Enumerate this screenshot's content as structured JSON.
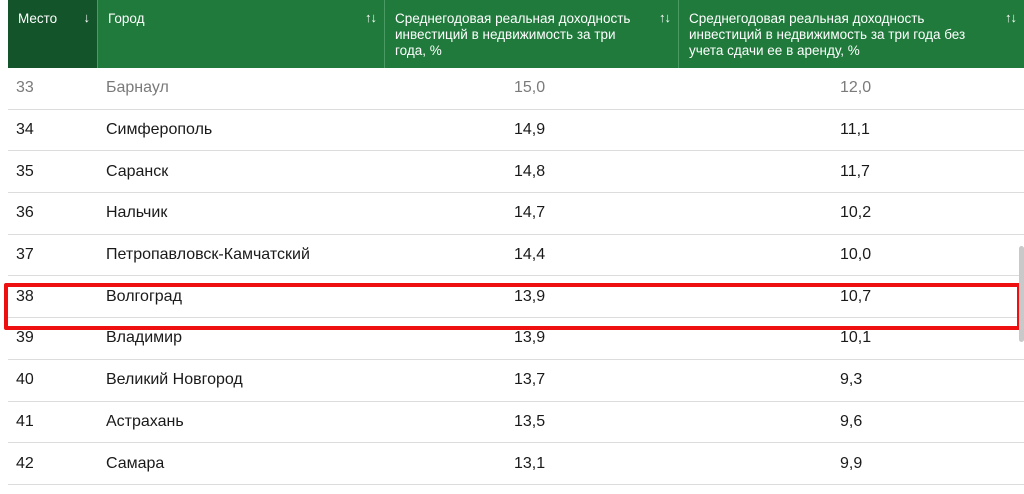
{
  "table": {
    "headers": {
      "place": "Место",
      "place_sort": "↓",
      "city": "Город",
      "city_sort": "↑↓",
      "yield": "Среднегодовая реальная доходность инвестиций в недвижимость за три года, %",
      "yield_sort": "↑↓",
      "yield_no_rent": "Среднегодовая реальная доходность инвестиций в недвижимость за три года без учета сдачи ее в аренду, %",
      "yield_no_rent_sort": "↑↓"
    },
    "rows": [
      {
        "place": "33",
        "city": "Барнаул",
        "yield": "15,0",
        "yield_no_rent": "12,0"
      },
      {
        "place": "34",
        "city": "Симферополь",
        "yield": "14,9",
        "yield_no_rent": "11,1"
      },
      {
        "place": "35",
        "city": "Саранск",
        "yield": "14,8",
        "yield_no_rent": "11,7"
      },
      {
        "place": "36",
        "city": "Нальчик",
        "yield": "14,7",
        "yield_no_rent": "10,2"
      },
      {
        "place": "37",
        "city": "Петропавловск-Камчатский",
        "yield": "14,4",
        "yield_no_rent": "10,0"
      },
      {
        "place": "38",
        "city": "Волгоград",
        "yield": "13,9",
        "yield_no_rent": "10,7"
      },
      {
        "place": "39",
        "city": "Владимир",
        "yield": "13,9",
        "yield_no_rent": "10,1"
      },
      {
        "place": "40",
        "city": "Великий Новгород",
        "yield": "13,7",
        "yield_no_rent": "9,3"
      },
      {
        "place": "41",
        "city": "Астрахань",
        "yield": "13,5",
        "yield_no_rent": "9,6"
      },
      {
        "place": "42",
        "city": "Самара",
        "yield": "13,1",
        "yield_no_rent": "9,9"
      }
    ],
    "highlighted_row": "38"
  },
  "colors": {
    "header_bg": "#1f7a3b",
    "header_sorted_bg": "#14542a",
    "highlight": "#ee1010"
  },
  "icons": {
    "sort_desc": "arrow-down-icon",
    "sort_both": "sort-both-icon"
  }
}
